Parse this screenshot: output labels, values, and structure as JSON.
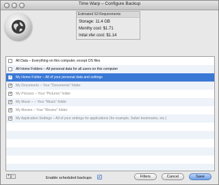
{
  "window": {
    "title": "Time Warp – Configure Backup"
  },
  "icons": {
    "drive": "globe-drive-icon",
    "plus": "plus-icon",
    "minus": "minus-icon",
    "checkbox": "checkbox-icon"
  },
  "s3_requirements": {
    "header": "Estimated S3 Requirements",
    "storage": "Storage:  11.4 GB",
    "monthly_cost": "Monthy cost:  $1.71",
    "initial_xfer_cost": "Inital xfer cost:  $1.14"
  },
  "backup_items": [
    {
      "label": "All Data – Everything on this computer, except OS files",
      "checked": false,
      "selected": false,
      "enabled": true
    },
    {
      "label": "All Home Folders – All personal data for all users on this computer",
      "checked": false,
      "selected": false,
      "enabled": true
    },
    {
      "label": "My Home Folder – All of your personal data and settings",
      "checked": true,
      "selected": true,
      "enabled": true
    },
    {
      "label": "My Documents – Your \"Documents\" folder",
      "checked": true,
      "selected": false,
      "enabled": false
    },
    {
      "label": "My Pictures – Your \"Pictures\" folder",
      "checked": true,
      "selected": false,
      "enabled": false
    },
    {
      "label": "My Music – – Your \"Music\" folder",
      "checked": true,
      "selected": false,
      "enabled": false
    },
    {
      "label": "My Movies – Your \"Movies\" folder",
      "checked": true,
      "selected": false,
      "enabled": false
    },
    {
      "label": "My Application Settings – All of your settings for applications (for example, Safari bookmarks, etc.)",
      "checked": true,
      "selected": false,
      "enabled": false
    }
  ],
  "footer": {
    "plus_label": "+",
    "minus_label": "−",
    "scheduled_label": "Enable scheduled backups",
    "scheduled_checked": true,
    "filters_label": "Filters",
    "cancel_label": "Cancel",
    "save_label": "Save"
  },
  "colors": {
    "selection": "#3a78d6",
    "alt_row": "#eef2f9",
    "default_button": "#6f9fe6"
  }
}
